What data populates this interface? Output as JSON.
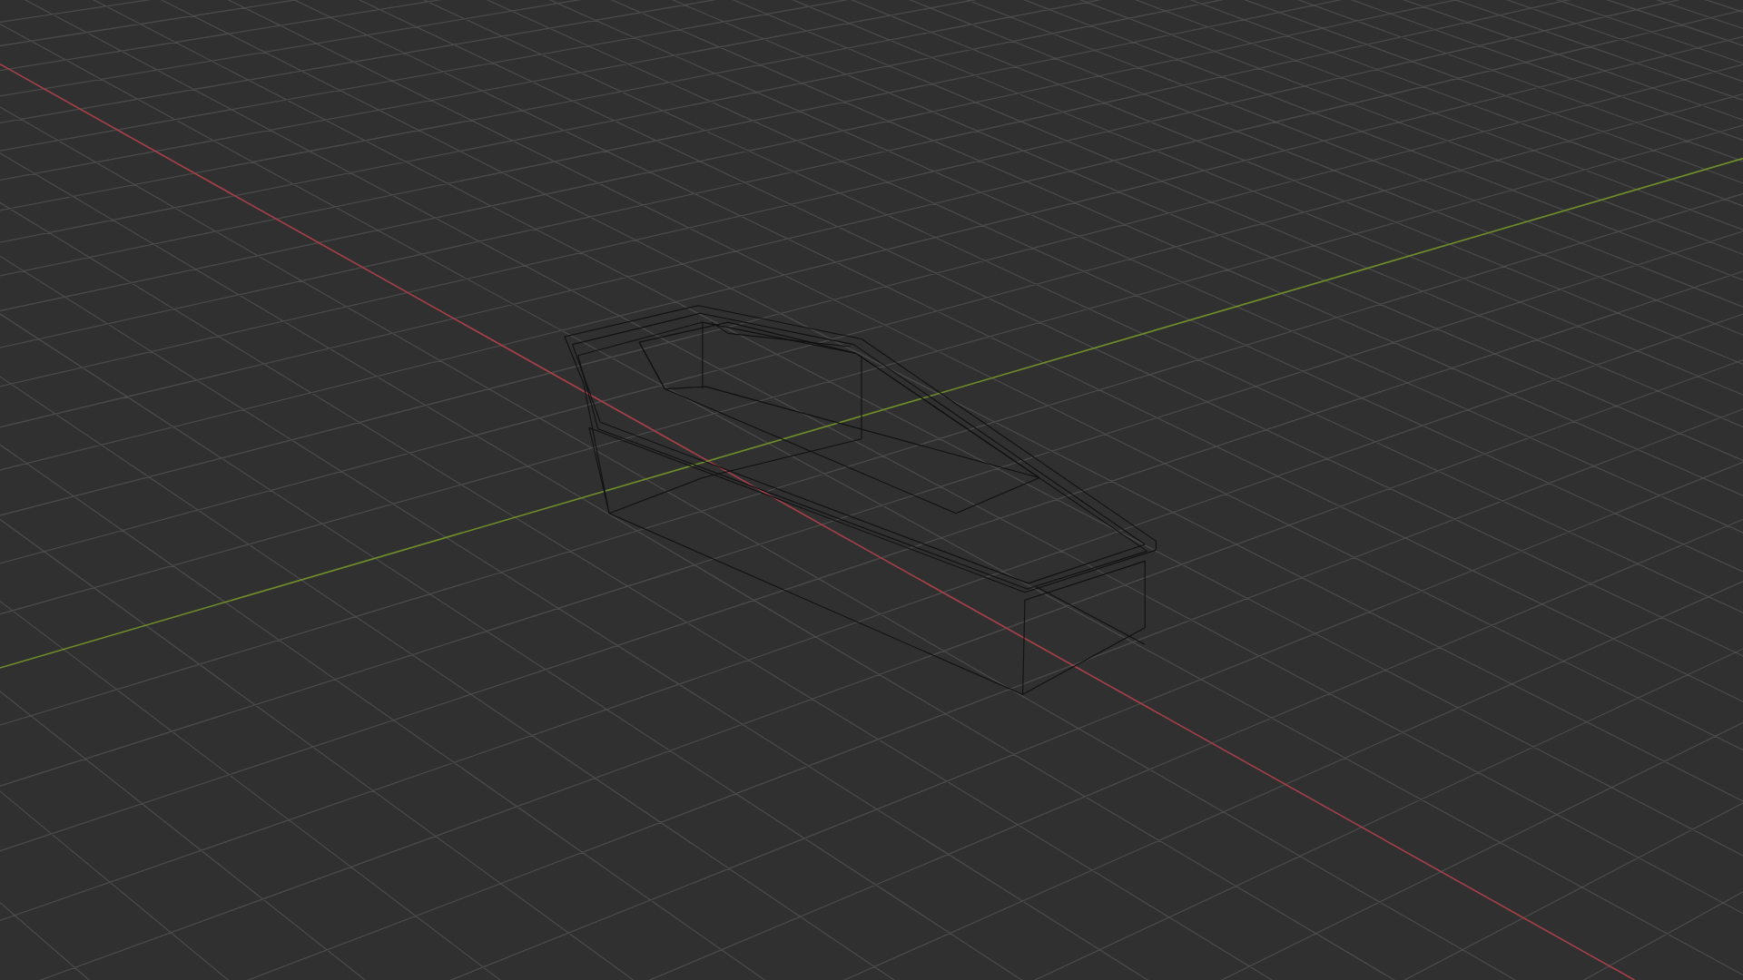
{
  "viewport": {
    "show_grid": true,
    "show_axes": true,
    "wireframe": true
  }
}
